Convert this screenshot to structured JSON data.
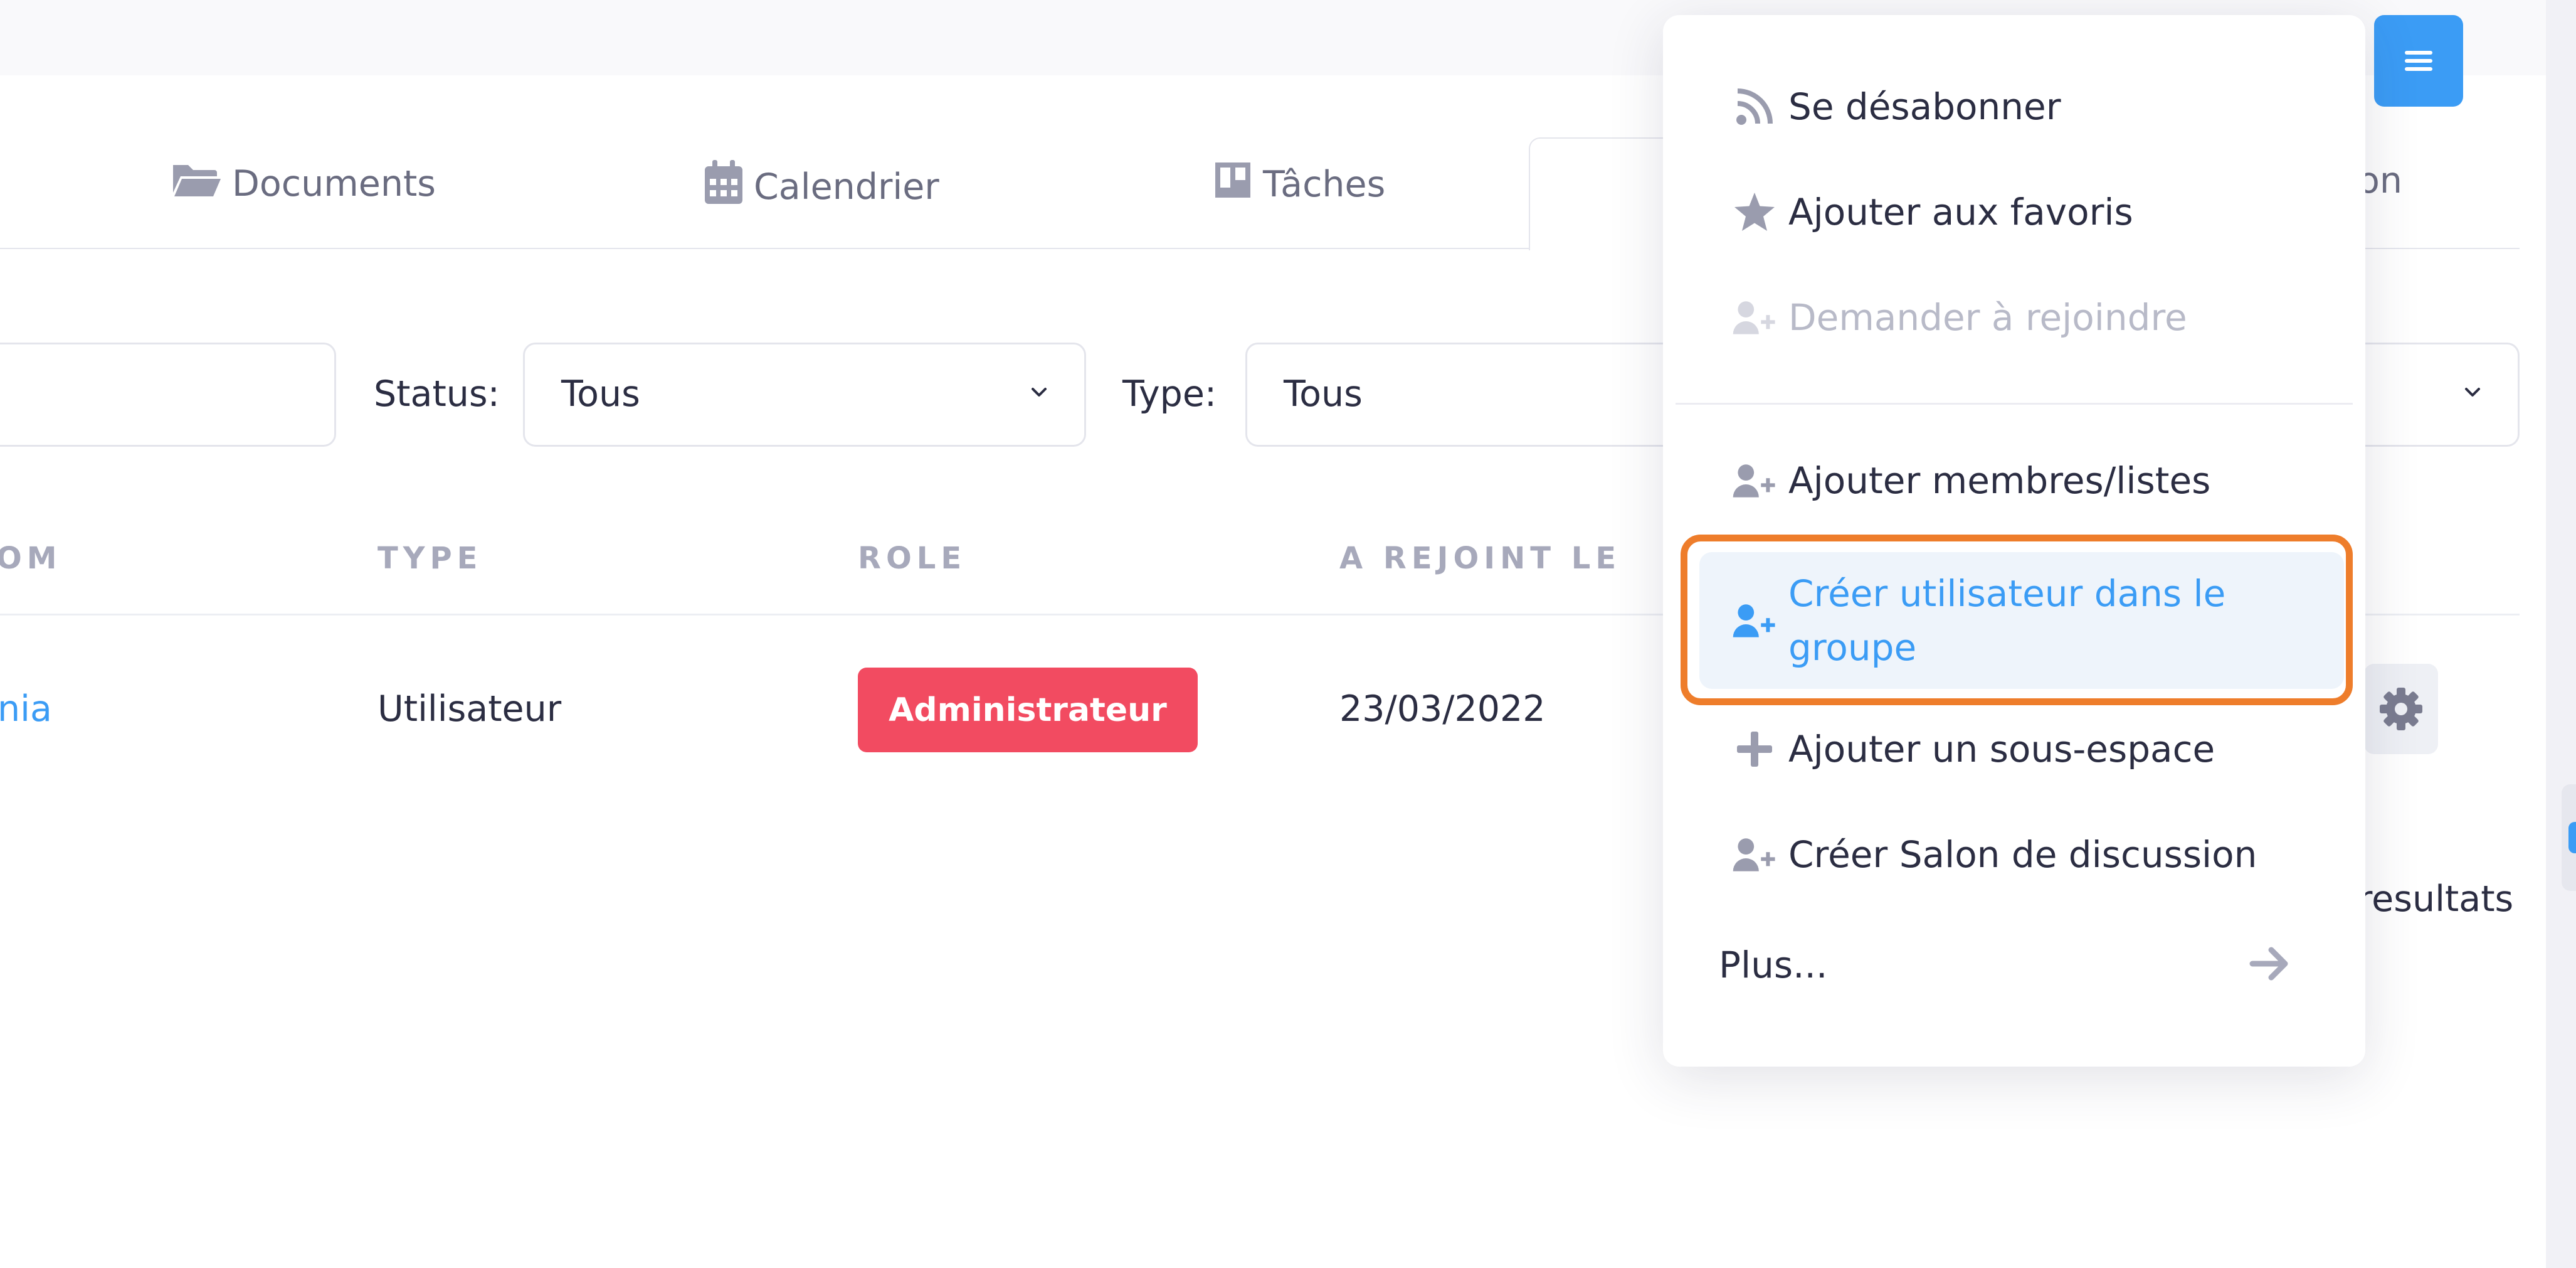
{
  "tabs": [
    {
      "label": "Documents",
      "icon": "folder-open-icon"
    },
    {
      "label": "Calendrier",
      "icon": "calendar-icon"
    },
    {
      "label": "Tâches",
      "icon": "kanban-icon"
    }
  ],
  "tab_partial_label": "on",
  "filters": {
    "status_label": "Status:",
    "status_value": "Tous",
    "type_label": "Type:",
    "type_value": "Tous"
  },
  "table": {
    "headers": [
      "OM",
      "TYPE",
      "ROLE",
      "A REJOINT LE"
    ],
    "row": {
      "name": "nia",
      "type": "Utilisateur",
      "role": "Administrateur",
      "joined": "23/03/2022"
    },
    "results_text": "resultats"
  },
  "menu": {
    "items": [
      {
        "label": "Se désabonner",
        "icon": "rss-icon",
        "state": "normal"
      },
      {
        "label": "Ajouter aux favoris",
        "icon": "star-icon",
        "state": "normal"
      },
      {
        "label": "Demander à rejoindre",
        "icon": "user-plus-icon",
        "state": "disabled"
      },
      {
        "label": "Ajouter membres/listes",
        "icon": "user-plus-icon",
        "state": "normal"
      },
      {
        "label": "Créer utilisateur dans le groupe",
        "icon": "user-plus-icon",
        "state": "highlighted"
      },
      {
        "label": "Ajouter un sous-espace",
        "icon": "plus-icon",
        "state": "normal"
      },
      {
        "label": "Créer Salon de discussion",
        "icon": "user-plus-icon",
        "state": "normal"
      }
    ],
    "more_label": "Plus...",
    "more_icon": "arrow-right-icon"
  },
  "colors": {
    "accent": "#3b9cf5",
    "badge_red": "#f24b61",
    "highlight_outline": "#ee7d2b",
    "muted_icon": "#9a9cae"
  }
}
